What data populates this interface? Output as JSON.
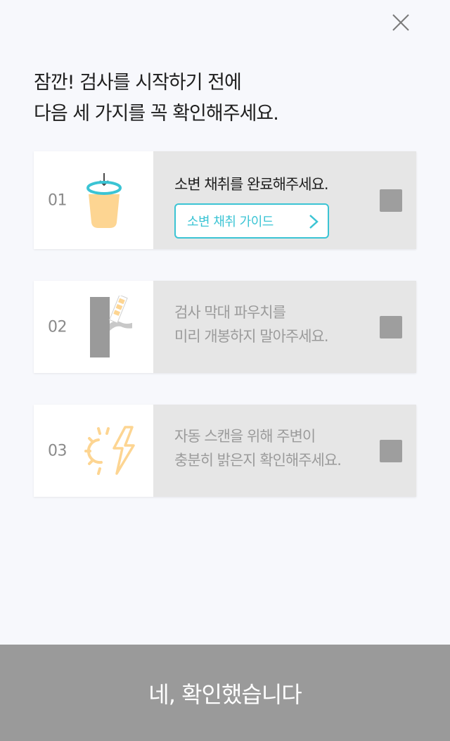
{
  "title": {
    "line1": "잠깐! 검사를 시작하기 전에",
    "line2": "다음 세 가지를 꼭 확인해주세요."
  },
  "steps": [
    {
      "number": "01",
      "icon": "cup-icon",
      "text_line1": "소변 채취를 완료해주세요.",
      "guide_button_label": "소변 채취 가이드"
    },
    {
      "number": "02",
      "icon": "test-stick-pouch-icon",
      "text_line1": "검사 막대 파우치를",
      "text_line2": "미리 개봉하지 말아주세요."
    },
    {
      "number": "03",
      "icon": "sun-lightning-icon",
      "text_line1": "자동 스캔을 위해 주변이",
      "text_line2": "충분히 밝은지 확인해주세요."
    }
  ],
  "confirm_button_label": "네, 확인했습니다",
  "colors": {
    "accent": "#3bc4d4",
    "card_bg": "#e6e6e6",
    "checkbox": "#9e9e9e",
    "confirm_bg": "#9a9a9a",
    "illustration_yellow": "#fdd592"
  }
}
